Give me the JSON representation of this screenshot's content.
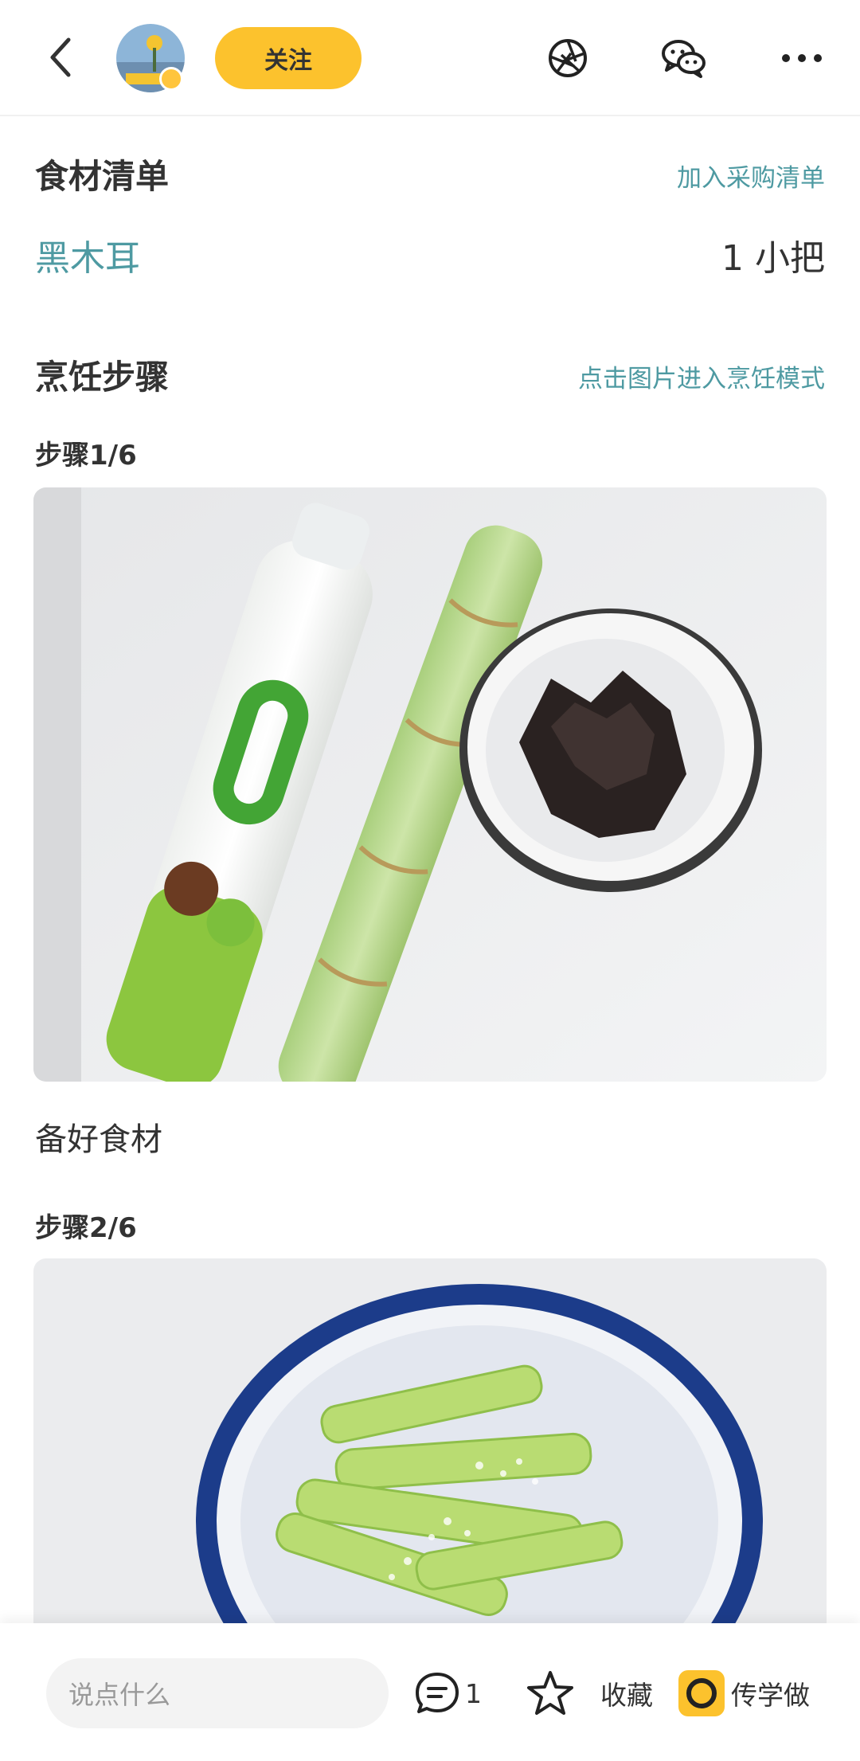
{
  "header": {
    "follow_label": "关注",
    "icons": [
      "back-icon",
      "avatar",
      "shutter-icon",
      "wechat-icon",
      "more-icon"
    ]
  },
  "ingredients": {
    "title": "食材清单",
    "action_label": "加入采购清单",
    "items": [
      {
        "name": "黑木耳",
        "amount": "1 小把"
      }
    ]
  },
  "steps": {
    "title": "烹饪步骤",
    "action_label": "点击图片进入烹饪模式",
    "items": [
      {
        "label": "步骤1/6",
        "description": "备好食材"
      },
      {
        "label": "步骤2/6",
        "description": ""
      }
    ]
  },
  "bottom_bar": {
    "comment_placeholder": "说点什么",
    "comment_count": "1",
    "favorite_label": "收藏",
    "cook_label": "传学做"
  },
  "colors": {
    "accent": "#fcc22d",
    "link": "#4e9aa2",
    "text": "#333333"
  }
}
